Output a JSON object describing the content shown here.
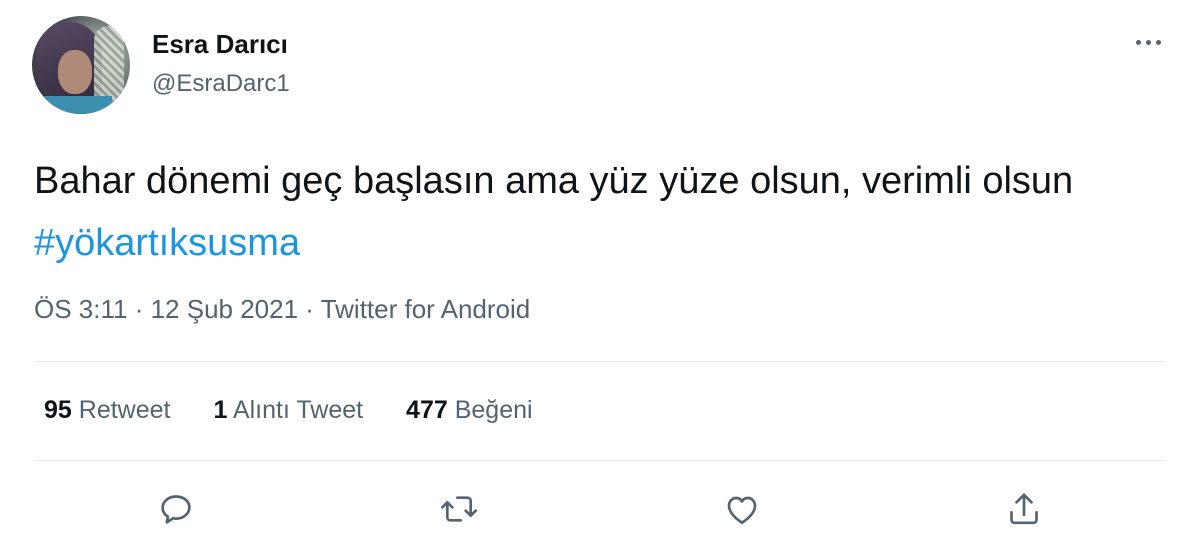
{
  "user": {
    "display_name": "Esra Darıcı",
    "handle": "@EsraDarc1"
  },
  "tweet": {
    "text_before": "Bahar dönemi geç başlasın ama yüz yüze olsun, verimli olsun ",
    "hashtag": "#yökartıksusma"
  },
  "meta": {
    "time": "ÖS 3:11",
    "separator": " · ",
    "date": "12 Şub 2021",
    "source": "Twitter for Android"
  },
  "stats": {
    "retweets_count": "95",
    "retweets_label": "Retweet",
    "quotes_count": "1",
    "quotes_label": "Alıntı Tweet",
    "likes_count": "477",
    "likes_label": "Beğeni"
  },
  "icons": {
    "more": "more-icon",
    "reply": "reply-icon",
    "retweet": "retweet-icon",
    "like": "heart-icon",
    "share": "share-icon"
  },
  "colors": {
    "hashtag": "#1b95e0",
    "secondary_text": "#536471",
    "primary_text": "#0f1419"
  }
}
